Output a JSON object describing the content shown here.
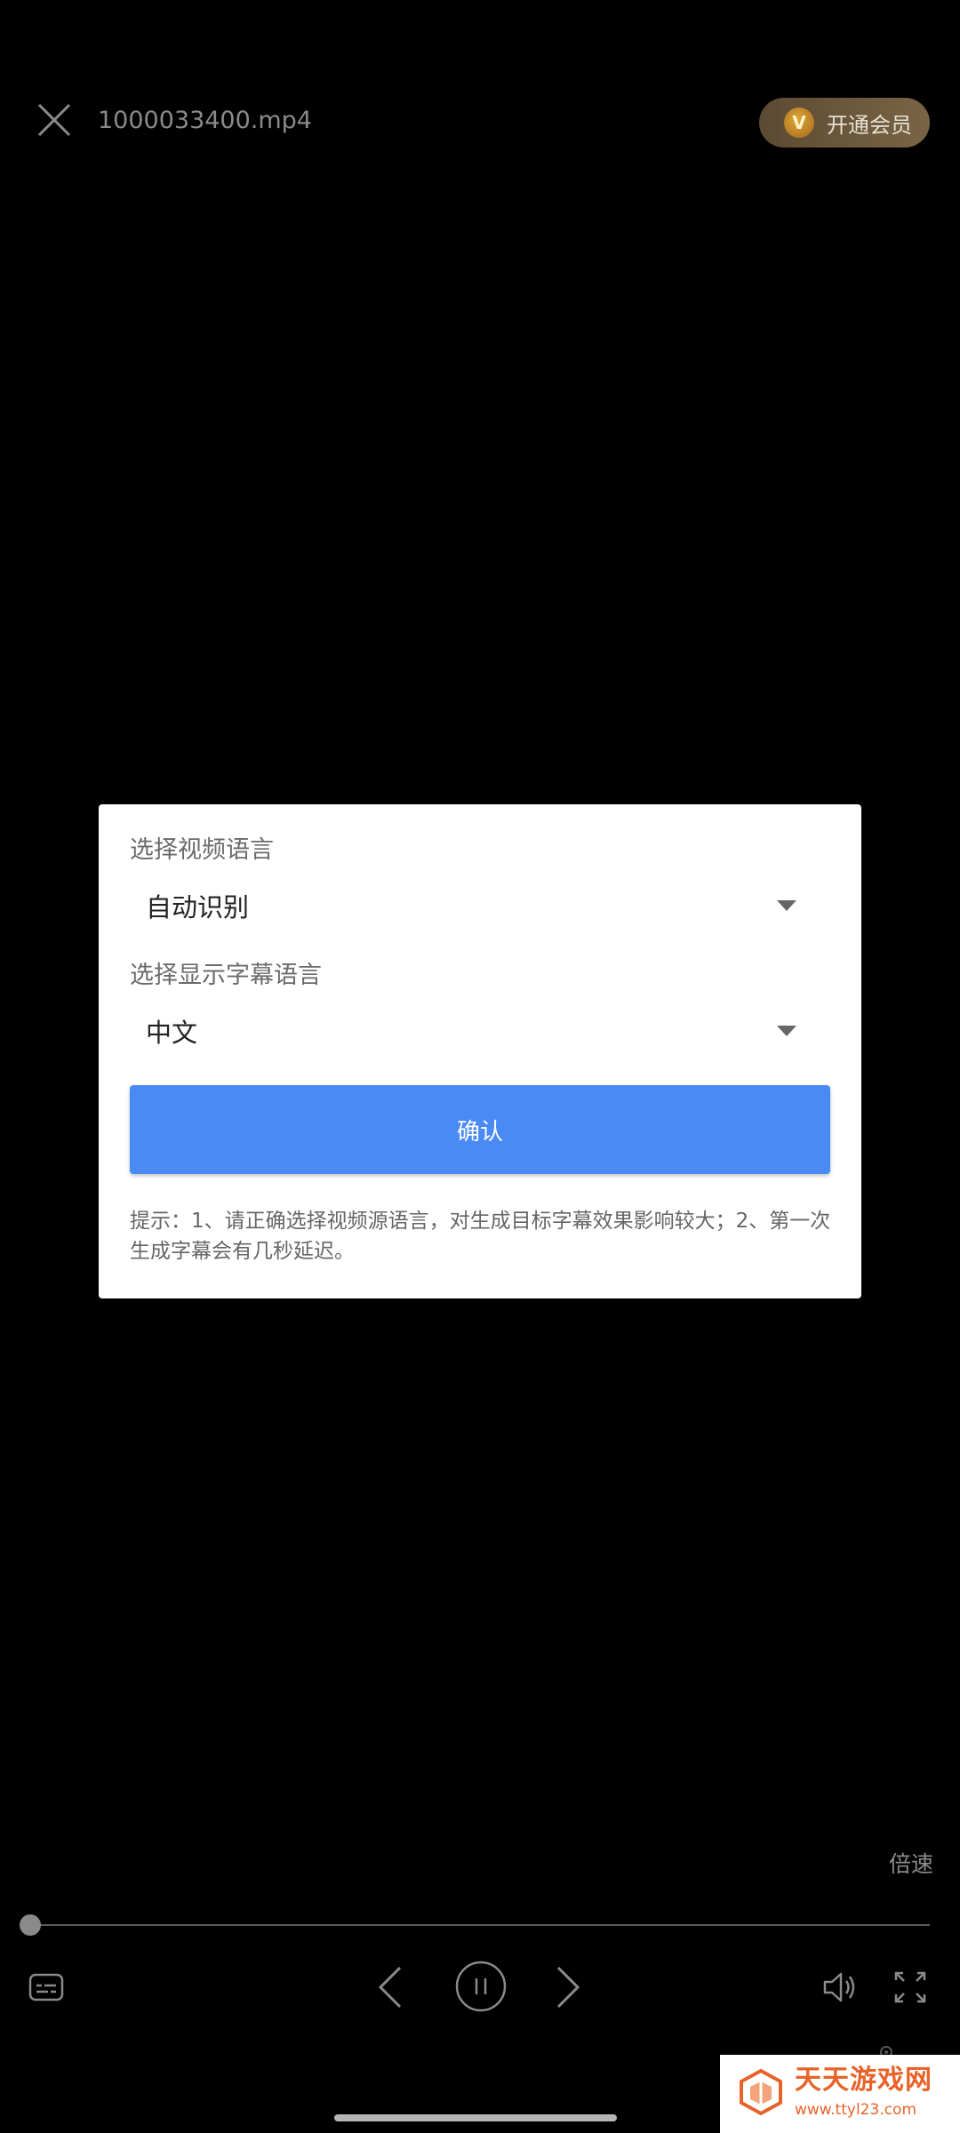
{
  "header": {
    "file_name": "1000033400.mp4",
    "vip_label": "开通会员",
    "vip_icon_glyph": "V"
  },
  "dialog": {
    "video_language_label": "选择视频语言",
    "video_language_value": "自动识别",
    "subtitle_language_label": "选择显示字幕语言",
    "subtitle_language_value": "中文",
    "confirm_label": "确认",
    "tip": "提示：1、请正确选择视频源语言，对生成目标字幕效果影响较大；2、第一次生成字幕会有几秒延迟。"
  },
  "player": {
    "speed_label": "倍速",
    "progress": 0
  },
  "watermark": {
    "title": "天天游戏网",
    "url": "www.ttyl23.com"
  },
  "colors": {
    "background": "#000000",
    "accent_blue": "#4a8af4",
    "vip_gold": "#b57b22",
    "watermark_orange": "#e8632a"
  },
  "icons": {
    "close": "close-icon",
    "subtitle": "subtitle-icon",
    "prev": "previous-icon",
    "pause": "pause-icon",
    "next": "next-icon",
    "volume": "volume-icon",
    "fullscreen": "fullscreen-icon"
  }
}
